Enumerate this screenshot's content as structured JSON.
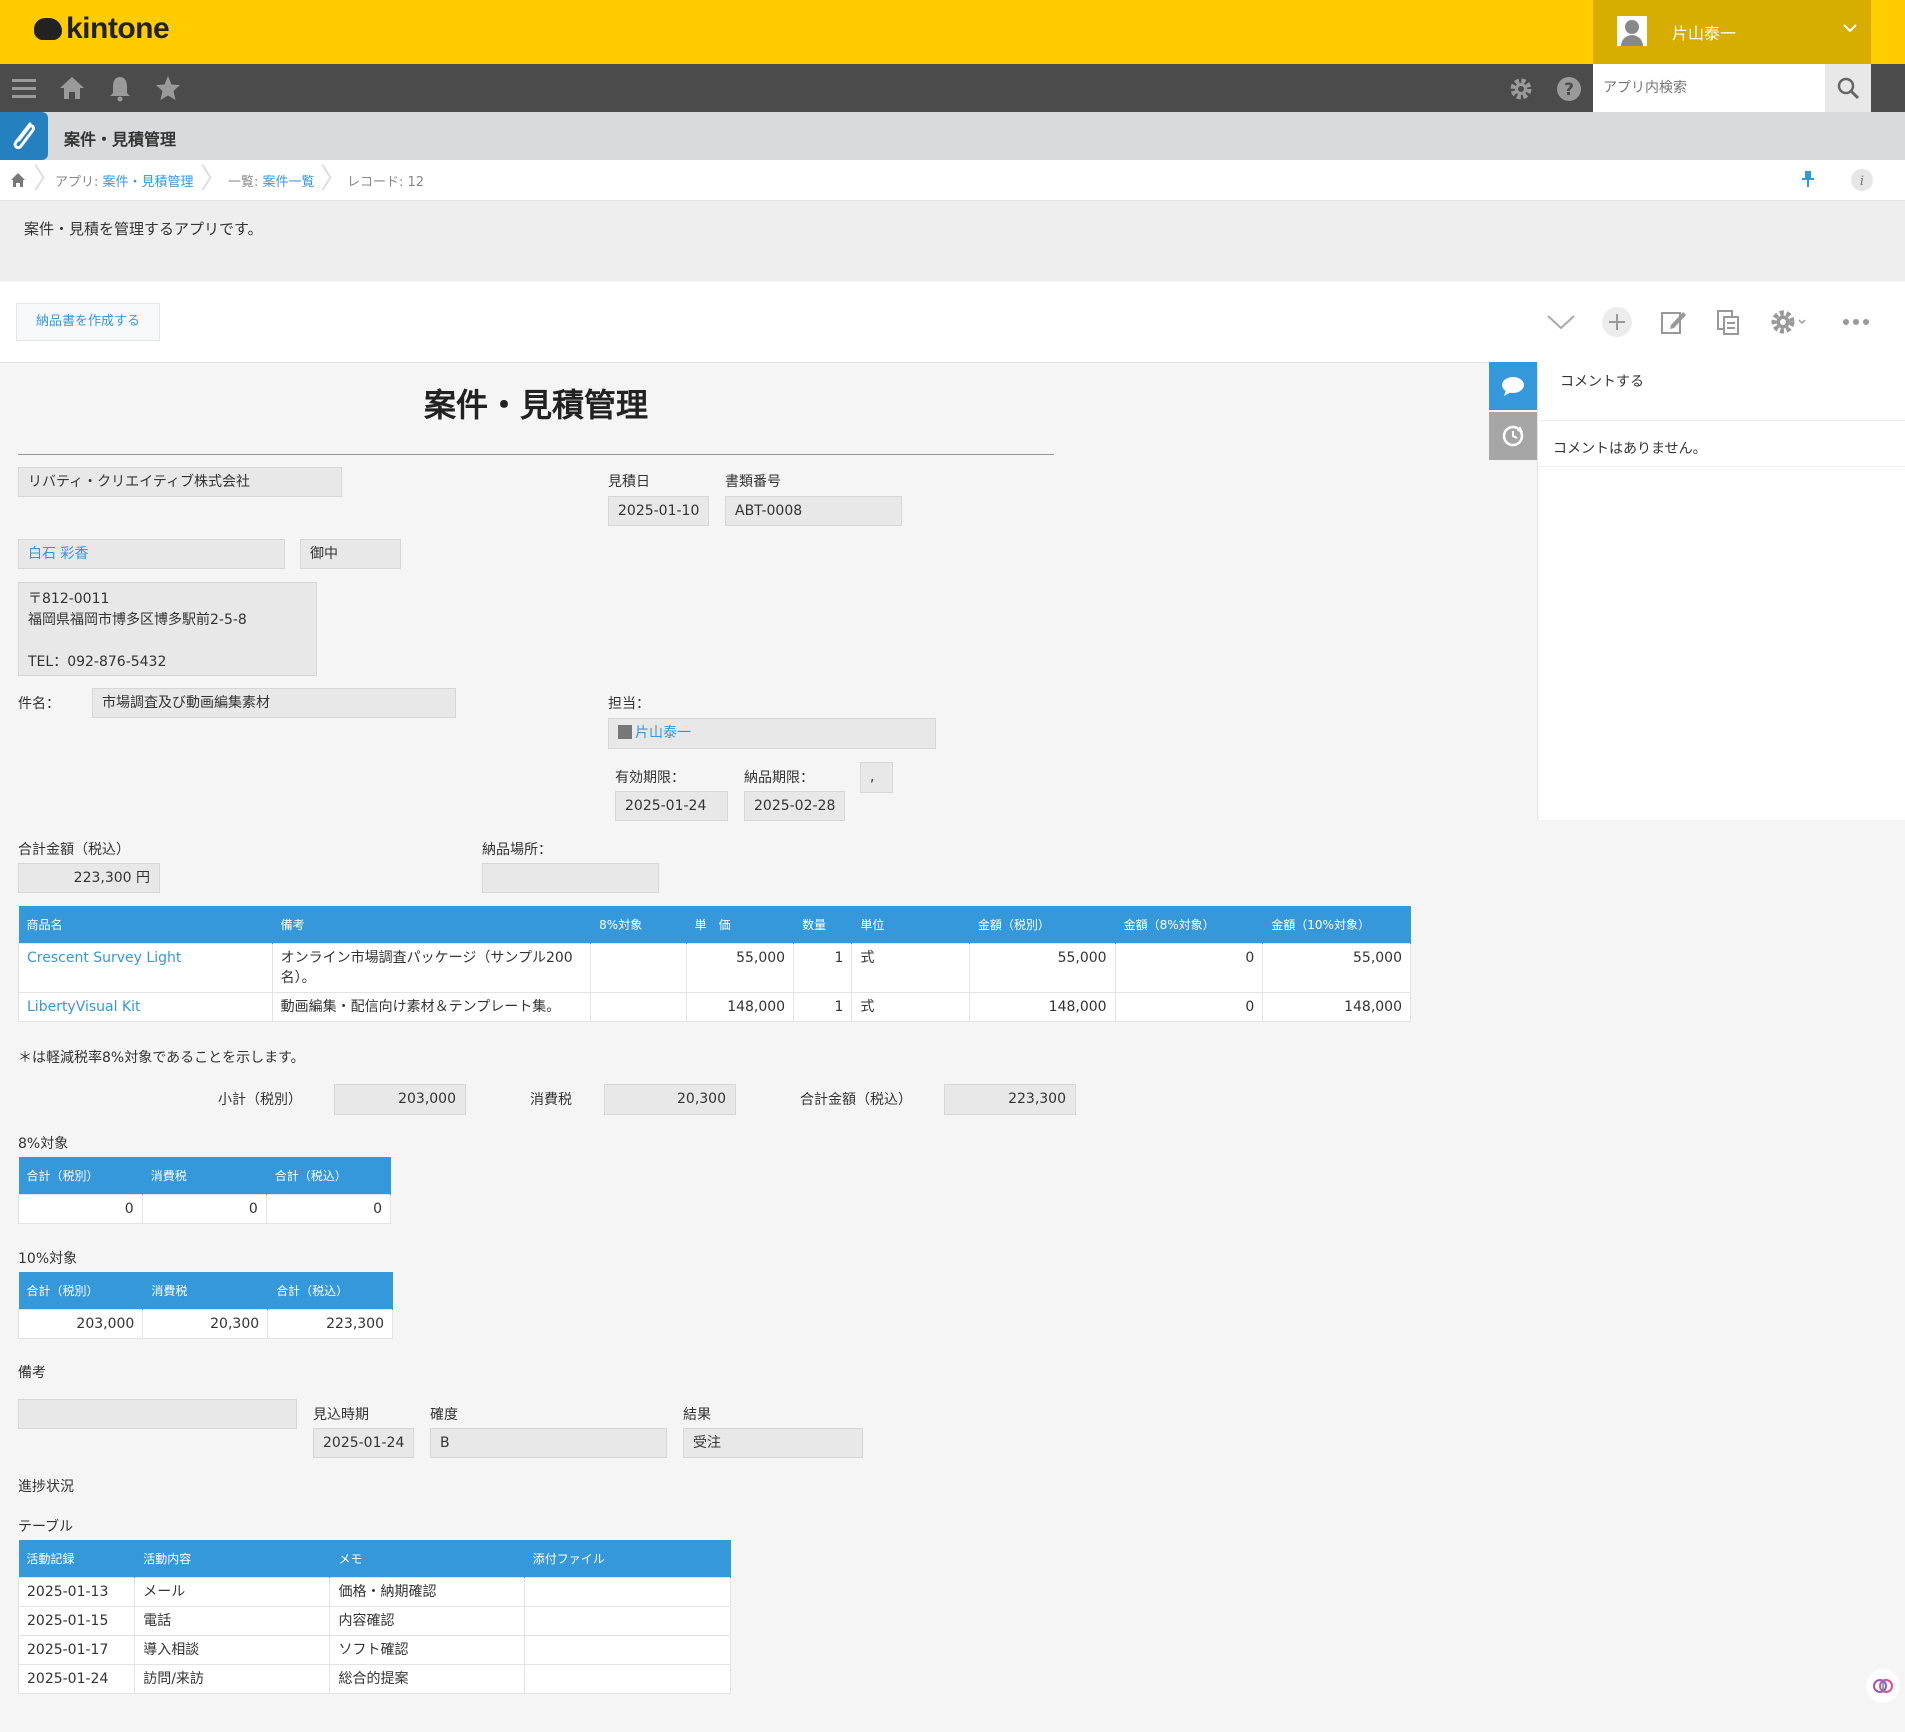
{
  "header": {
    "logo": "kintone",
    "user_name": "片山泰一",
    "search_placeholder": "アプリ内検索"
  },
  "app": {
    "title": "案件・見積管理",
    "description": "案件・見積を管理するアプリです。"
  },
  "breadcrumb": {
    "app_prefix": "アプリ: ",
    "app_name": "案件・見積管理",
    "view_prefix": "一覧: ",
    "view_name": "案件一覧",
    "record": "レコード: 12"
  },
  "toolbar": {
    "action_button": "納品書を作成する"
  },
  "comments": {
    "write_label": "コメントする",
    "empty_text": "コメントはありません。"
  },
  "form": {
    "title": "案件・見積管理",
    "company": "リバティ・クリエイティブ株式会社",
    "estimate_date_label": "見積日",
    "estimate_date": "2025-01-10",
    "doc_no_label": "書類番号",
    "doc_no": "ABT-0008",
    "contact_name": "白石 彩香",
    "honorific": "御中",
    "address_lines": [
      "〒812-0011",
      "福岡県福岡市博多区博多駅前2-5-8",
      "",
      "TEL：092-876-5432"
    ],
    "subject_label": "件名：",
    "subject": "市場調査及び動画編集素材",
    "staff_label": "担当：",
    "staff": "片山泰一",
    "valid_until_label": "有効期限：",
    "valid_until": "2025-01-24",
    "delivery_deadline_label": "納品期限：",
    "delivery_deadline": "2025-02-28",
    "misc_value": ",",
    "total_label": "合計金額（税込）",
    "total_value": "223,300 円",
    "delivery_place_label": "納品場所：",
    "delivery_place": "",
    "items_headers": [
      "商品名",
      "備考",
      "8%対象",
      "単　価",
      "数量",
      "単位",
      "金額（税別）",
      "金額（8%対象）",
      "金額（10%対象）"
    ],
    "items": [
      [
        "Crescent Survey Light",
        "オンライン市場調査パッケージ（サンプル200名）。",
        "",
        "55,000",
        "1",
        "式",
        "55,000",
        "0",
        "55,000"
      ],
      [
        "LibertyVisual Kit",
        "動画編集・配信向け素材＆テンプレート集。",
        "",
        "148,000",
        "1",
        "式",
        "148,000",
        "0",
        "148,000"
      ]
    ],
    "note": "＊は軽減税率8%対象であることを示します。",
    "subtotal_label": "小計（税別）",
    "subtotal": "203,000",
    "tax_label": "消費税",
    "tax": "20,300",
    "grand_total_label": "合計金額（税込）",
    "grand_total": "223,300",
    "rate8_label": "8%対象",
    "rate8_headers": [
      "合計（税別）",
      "消費税",
      "合計（税込）"
    ],
    "rate8_row": [
      "0",
      "0",
      "0"
    ],
    "rate10_label": "10%対象",
    "rate10_headers": [
      "合計（税別）",
      "消費税",
      "合計（税込）"
    ],
    "rate10_row": [
      "203,000",
      "20,300",
      "223,300"
    ],
    "remarks_label": "備考",
    "remarks": "",
    "expected_label": "見込時期",
    "expected": "2025-01-24",
    "certainty_label": "確度",
    "certainty": "B",
    "result_label": "結果",
    "result": "受注",
    "progress_label": "進捗状況",
    "activity_table_label": "テーブル",
    "activity_headers": [
      "活動記録",
      "活動内容",
      "メモ",
      "添付ファイル"
    ],
    "activities": [
      [
        "2025-01-13",
        "メール",
        "価格・納期確認",
        ""
      ],
      [
        "2025-01-15",
        "電話",
        "内容確認",
        ""
      ],
      [
        "2025-01-17",
        "導入相談",
        "ソフト確認",
        ""
      ],
      [
        "2025-01-24",
        "訪問/来訪",
        "総合的提案",
        ""
      ]
    ]
  }
}
